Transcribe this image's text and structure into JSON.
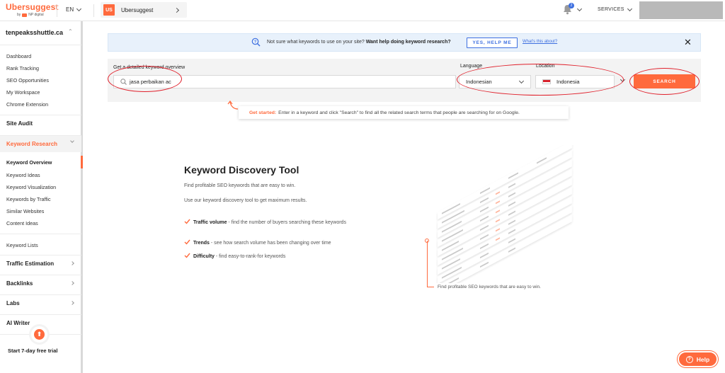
{
  "topbar": {
    "logo_text": "Ubersuggest",
    "logo_by": "by",
    "logo_by_brand": "NP digital",
    "language": "EN",
    "project_badge": "US",
    "project_name": "Ubersuggest",
    "notification_count": "2",
    "services_label": "SERVICES"
  },
  "sidebar": {
    "site_name": "tenpeaksshuttle.ca",
    "top_links": [
      "Dashboard",
      "Rank Tracking",
      "SEO Opportunities",
      "My Workspace",
      "Chrome Extension"
    ],
    "site_audit": "Site Audit",
    "keyword_research": "Keyword Research",
    "keyword_links": [
      "Keyword Overview",
      "Keyword Ideas",
      "Keyword Visualization",
      "Keywords by Traffic",
      "Similar Websites",
      "Content Ideas"
    ],
    "keyword_lists": "Keyword Lists",
    "traffic_estimation": "Traffic Estimation",
    "backlinks": "Backlinks",
    "labs": "Labs",
    "ai_writer": "AI Writer",
    "trial_text": "Start 7-day free trial"
  },
  "banner": {
    "message_plain": "Not sure what keywords to use on your site?",
    "message_bold": "Want help doing keyword research?",
    "yes_button": "YES, HELP ME",
    "about_link": "What's this about?",
    "close": "✕"
  },
  "search": {
    "keyword_label": "Get a detailed keyword overview",
    "keyword_value": "jasa perbaikan ac",
    "language_label": "Language",
    "language_value": "Indonesian",
    "location_label": "Location",
    "location_value": "Indonesia",
    "search_button": "SEARCH"
  },
  "tip": {
    "bold": "Get started:",
    "text": "Enter in a keyword and click \"Search\" to find all the related search terms that people are searching for on Google."
  },
  "discovery": {
    "title": "Keyword Discovery Tool",
    "p1": "Find profitable SEO keywords that are easy to win.",
    "p2": "Use our keyword discovery tool to get maximum results.",
    "features": [
      {
        "bold": "Traffic volume",
        "text": " - find the number of buyers searching these keywords"
      },
      {
        "bold": "Trends",
        "text": " - see how search volume has been changing over time"
      },
      {
        "bold": "Difficulty",
        "text": " - find easy-to-rank-for keywords"
      }
    ],
    "caption": "Find profitable SEO keywords that are easy to win."
  },
  "help": {
    "label": "Help",
    "icon": "?"
  },
  "colors": {
    "accent": "#ff6a3d",
    "link_blue": "#3d6fe0",
    "annotation_red": "#e0202b"
  }
}
